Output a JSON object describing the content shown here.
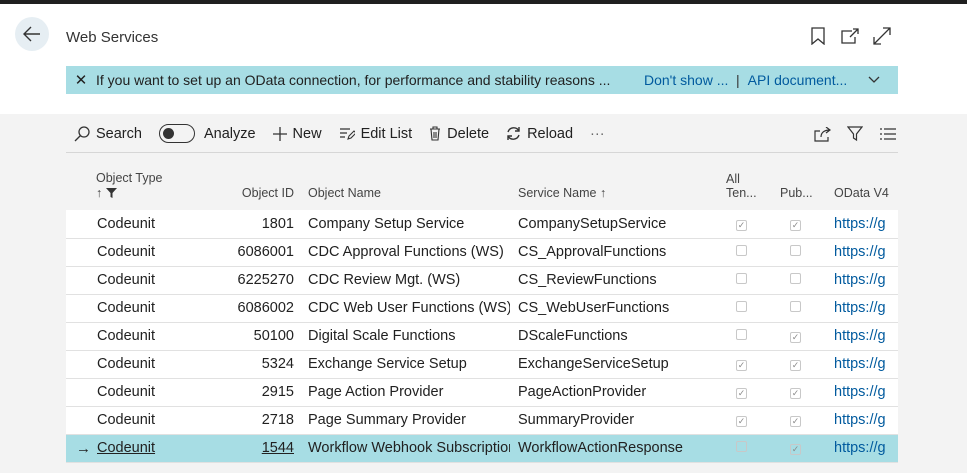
{
  "page": {
    "title": "Web Services",
    "back_icon": "arrow-left-icon",
    "header_actions": [
      "bookmark-icon",
      "open-new-window-icon",
      "expand-icon"
    ]
  },
  "banner": {
    "message": "If you want to set up an OData connection, for performance and stability reasons ...",
    "action_dont_show": "Don't show ...",
    "separator": "|",
    "action_api_docs": "API document...",
    "color": "#a7dde4"
  },
  "toolbar": {
    "search": "Search",
    "analyze": "Analyze",
    "new": "New",
    "edit_list": "Edit List",
    "delete": "Delete",
    "reload": "Reload",
    "more": "···"
  },
  "table": {
    "columns": {
      "object_type": "Object Type",
      "object_type_sort": "↑",
      "object_id": "Object ID",
      "object_name": "Object Name",
      "service_name": "Service Name ↑",
      "all_tenants_line1": "All",
      "all_tenants_line2": "Ten...",
      "published": "Pub...",
      "odata_v4": "OData V4"
    },
    "rows": [
      {
        "type": "Codeunit",
        "id": "1801",
        "name": "Company Setup Service",
        "service": "CompanySetupService",
        "all_tenants": true,
        "published": true,
        "odata": "https://g"
      },
      {
        "type": "Codeunit",
        "id": "6086001",
        "name": "CDC Approval Functions (WS)",
        "service": "CS_ApprovalFunctions",
        "all_tenants": false,
        "published": false,
        "odata": "https://g"
      },
      {
        "type": "Codeunit",
        "id": "6225270",
        "name": "CDC Review Mgt. (WS)",
        "service": "CS_ReviewFunctions",
        "all_tenants": false,
        "published": false,
        "odata": "https://g"
      },
      {
        "type": "Codeunit",
        "id": "6086002",
        "name": "CDC Web User Functions (WS)",
        "service": "CS_WebUserFunctions",
        "all_tenants": false,
        "published": false,
        "odata": "https://g"
      },
      {
        "type": "Codeunit",
        "id": "50100",
        "name": "Digital Scale Functions",
        "service": "DScaleFunctions",
        "all_tenants": false,
        "published": true,
        "odata": "https://g"
      },
      {
        "type": "Codeunit",
        "id": "5324",
        "name": "Exchange Service Setup",
        "service": "ExchangeServiceSetup",
        "all_tenants": true,
        "published": true,
        "odata": "https://g"
      },
      {
        "type": "Codeunit",
        "id": "2915",
        "name": "Page Action Provider",
        "service": "PageActionProvider",
        "all_tenants": true,
        "published": true,
        "odata": "https://g"
      },
      {
        "type": "Codeunit",
        "id": "2718",
        "name": "Page Summary Provider",
        "service": "SummaryProvider",
        "all_tenants": true,
        "published": true,
        "odata": "https://g"
      },
      {
        "type": "Codeunit",
        "id": "1544",
        "name": "Workflow Webhook Subscription",
        "service": "WorkflowActionResponse",
        "all_tenants": false,
        "published": true,
        "odata": "https://g",
        "selected": true
      }
    ]
  }
}
